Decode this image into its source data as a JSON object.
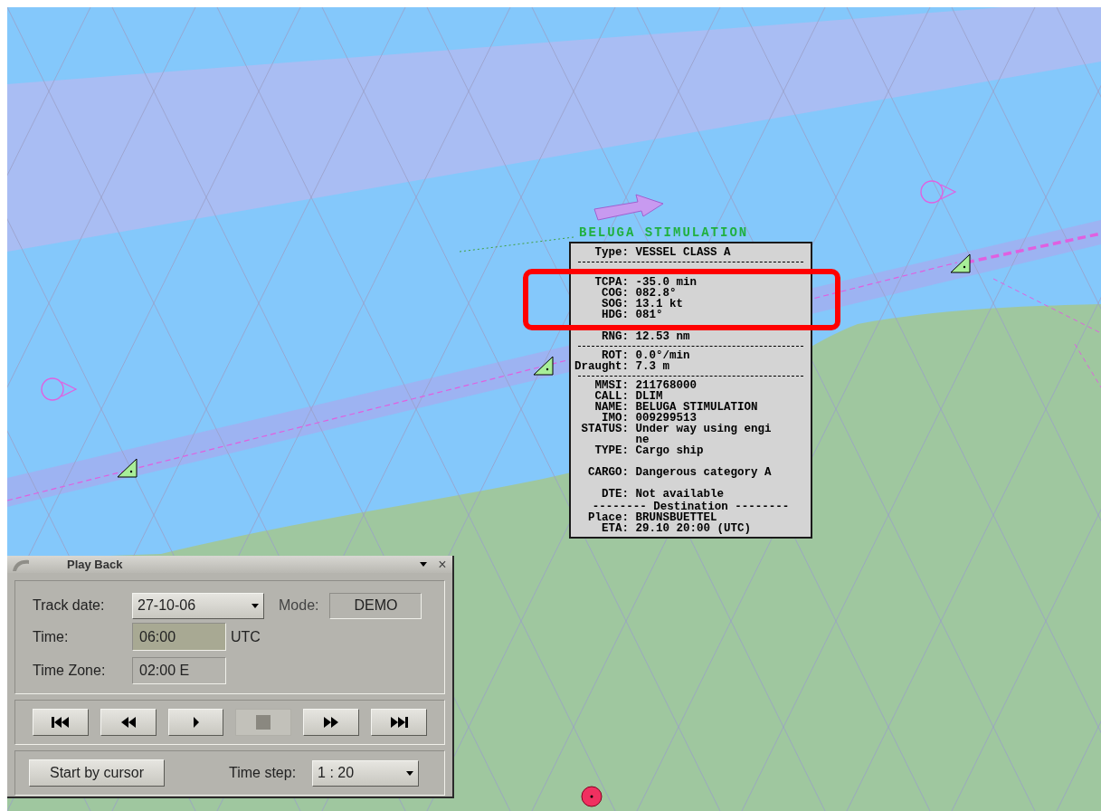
{
  "map": {
    "vessel_label": "BELUGA STIMULATION"
  },
  "target_popup": {
    "header": {
      "label": "Type:",
      "value": "VESSEL CLASS A"
    },
    "rows": [
      {
        "kind": "rule"
      },
      {
        "kind": "hidden"
      },
      {
        "kind": "field",
        "label": "TCPA:",
        "value": "-35.0 min"
      },
      {
        "kind": "field",
        "label": "COG:",
        "value": "082.8°"
      },
      {
        "kind": "field",
        "label": "SOG:",
        "value": "13.1 kt"
      },
      {
        "kind": "field",
        "label": "HDG:",
        "value": "081°"
      },
      {
        "kind": "hidden"
      },
      {
        "kind": "field",
        "label": "RNG:",
        "value": "12.53 nm"
      },
      {
        "kind": "rule"
      },
      {
        "kind": "field",
        "label": "ROT:",
        "value": "0.0°/min"
      },
      {
        "kind": "field",
        "label": "Draught:",
        "value": "7.3 m"
      },
      {
        "kind": "rule"
      },
      {
        "kind": "field",
        "label": "MMSI:",
        "value": "211768000"
      },
      {
        "kind": "field",
        "label": "CALL:",
        "value": "DLIM"
      },
      {
        "kind": "field",
        "label": "NAME:",
        "value": "BELUGA STIMULATION"
      },
      {
        "kind": "field",
        "label": "IMO:",
        "value": "009299513"
      },
      {
        "kind": "field",
        "label": "STATUS:",
        "value": "Under way using engine"
      },
      {
        "kind": "field",
        "label": "TYPE:",
        "value": "Cargo ship"
      },
      {
        "kind": "hidden"
      },
      {
        "kind": "field",
        "label": "CARGO:",
        "value": "Dangerous category A"
      },
      {
        "kind": "hidden"
      },
      {
        "kind": "field",
        "label": "DTE:",
        "value": "Not available"
      },
      {
        "kind": "section",
        "title": "-------- Destination --------"
      },
      {
        "kind": "field",
        "label": "Place:",
        "value": "BRUNSBUETTEL"
      },
      {
        "kind": "field",
        "label": "ETA:",
        "value": "29.10 20:00 (UTC)"
      }
    ]
  },
  "playback": {
    "title": "Play Back",
    "close": "×",
    "track_date": {
      "label": "Track date:",
      "value": "27-10-06"
    },
    "mode": {
      "label": "Mode:",
      "value": "DEMO"
    },
    "time": {
      "label": "Time:",
      "value": "06:00",
      "unit": "UTC"
    },
    "time_zone": {
      "label": "Time Zone:",
      "value": "02:00 E"
    },
    "transport": [
      {
        "kind": "first",
        "disabled": false
      },
      {
        "kind": "rewind",
        "disabled": false
      },
      {
        "kind": "play",
        "disabled": false
      },
      {
        "kind": "stop",
        "disabled": true
      },
      {
        "kind": "forward",
        "disabled": false
      },
      {
        "kind": "last",
        "disabled": false
      }
    ],
    "start_button": "Start by cursor",
    "time_step": {
      "label": "Time step:",
      "value": "1 : 20"
    }
  }
}
